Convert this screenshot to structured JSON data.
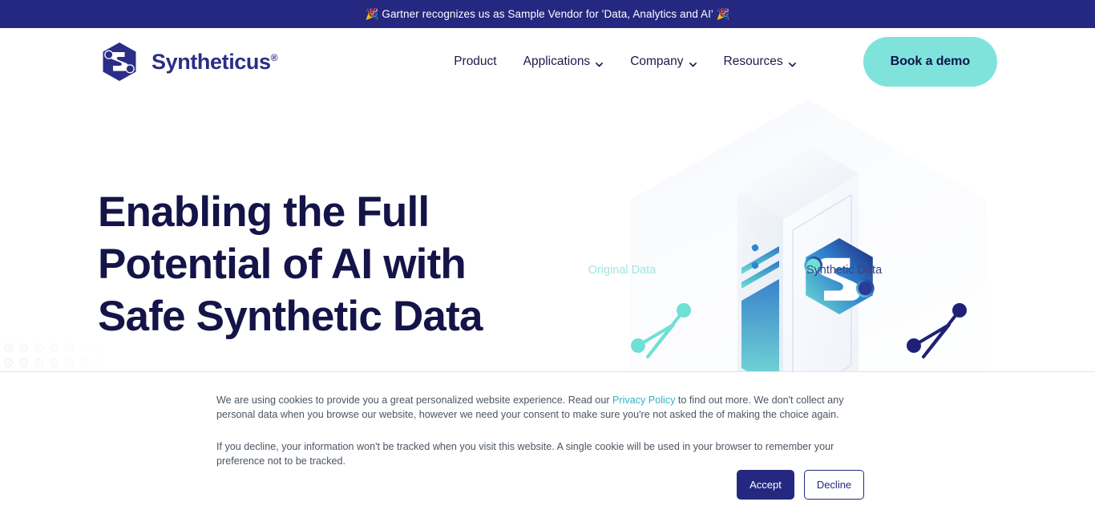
{
  "announcement": {
    "text": "🎉 Gartner recognizes us as Sample Vendor for 'Data, Analytics and AI' 🎉",
    "background": "#242880",
    "color": "#ffffff"
  },
  "header": {
    "brand_name": "Syntheticus",
    "brand_registered": "®",
    "logo_icon": "syntheticus-hexagon-logo",
    "nav": [
      {
        "label": "Product",
        "has_dropdown": false
      },
      {
        "label": "Applications",
        "has_dropdown": true
      },
      {
        "label": "Company",
        "has_dropdown": true
      },
      {
        "label": "Resources",
        "has_dropdown": true
      }
    ],
    "cta": {
      "label": "Book a demo",
      "background": "#7FE3DC",
      "color": "#11124A"
    }
  },
  "hero": {
    "title": "Enabling the Full Potential of AI with Safe Synthetic Data",
    "title_color": "#141449",
    "illustration": {
      "original_label": "Original Data",
      "original_color": "#6FE0D4",
      "synthetic_label": "Synthetic Data",
      "synthetic_color": "#1F2176",
      "server_icon": "server-tower-icon"
    }
  },
  "cookie_consent": {
    "paragraph1_before_link": "We are using cookies to provide you a great personalized website experience. Read our ",
    "link_label": "Privacy Policy",
    "link_color": "#35B2C4",
    "paragraph1_after_link": " to find out more. We don't collect any personal data when you browse our website, however we need your consent to make sure you're not asked the of making the choice again.",
    "paragraph2": "If you decline, your information won't be tracked when you visit this website. A single cookie will be used in your browser to remember your preference not to be tracked.",
    "accept_label": "Accept",
    "decline_label": "Decline",
    "accept_background": "#242880",
    "decline_border": "#242880"
  }
}
